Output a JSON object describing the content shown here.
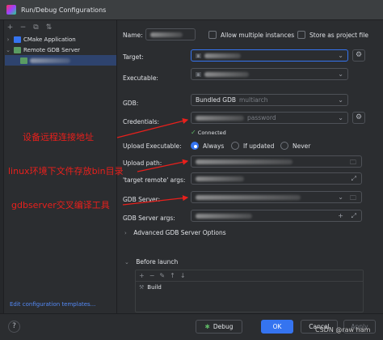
{
  "window": {
    "title": "Run/Debug Configurations"
  },
  "sidebar": {
    "toolbar": [
      "+",
      "−",
      "⧉",
      "⇅"
    ],
    "items": [
      {
        "label": "CMake Application",
        "expanded": false
      },
      {
        "label": "Remote GDB Server",
        "expanded": true
      }
    ],
    "edit_templates_link": "Edit configuration templates..."
  },
  "form": {
    "name_label": "Name:",
    "allow_multiple_label": "Allow multiple instances",
    "store_project_label": "Store as project file",
    "target_label": "Target:",
    "executable_label": "Executable:",
    "gdb_label": "GDB:",
    "gdb_value": "Bundled GDB",
    "gdb_hint": "multiarch",
    "credentials_label": "Credentials:",
    "credentials_hint": "password",
    "connected_text": "Connected",
    "upload_exec_label": "Upload Executable:",
    "upload_options": [
      "Always",
      "If updated",
      "Never"
    ],
    "upload_selected": "Always",
    "upload_path_label": "Upload path:",
    "target_remote_label": "'target remote' args:",
    "gdb_server_label": "GDB Server:",
    "gdb_server_args_label": "GDB Server args:",
    "advanced_label": "Advanced GDB Server Options",
    "before_launch_label": "Before launch",
    "before_launch_items": [
      {
        "label": "Build"
      }
    ]
  },
  "annotations": {
    "remote_address": "设备远程连接地址",
    "upload_dir": "linux环境下文件存放bin目录",
    "gdbserver": "gdbserver交叉编译工具"
  },
  "footer": {
    "debug_label": "Debug",
    "ok_label": "OK",
    "cancel_label": "Cancel",
    "apply_label": "Apply"
  },
  "watermark": "CSDN @raw ham",
  "colors": {
    "accent": "#3574f0",
    "annotation": "#e8201c",
    "connected": "#5fb865"
  }
}
